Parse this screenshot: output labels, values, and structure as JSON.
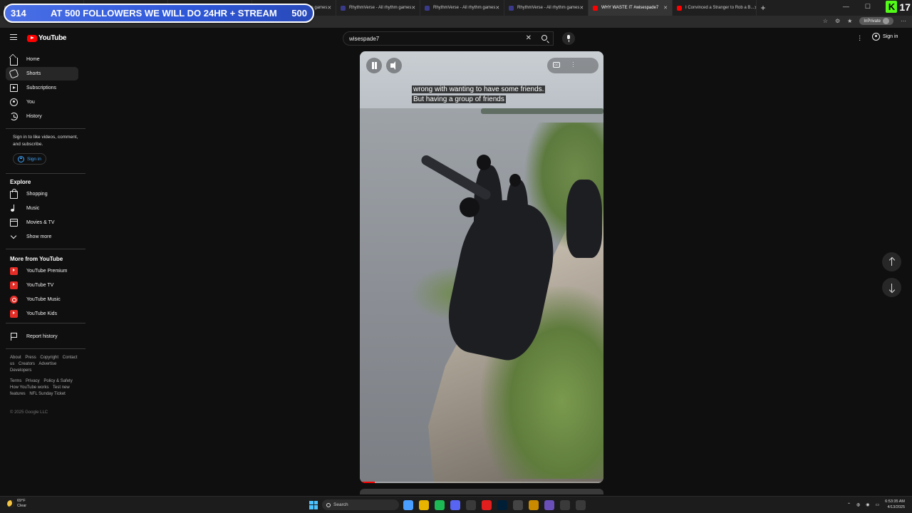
{
  "browser": {
    "tabs": [
      {
        "title": "",
        "color": "#6a6a6a"
      },
      {
        "title": "",
        "color": "#6a6a6a"
      },
      {
        "title": "",
        "color": "#6a6a6a"
      },
      {
        "title": "RhythmVerse - All rhythm games",
        "color": "#3a3a8a"
      },
      {
        "title": "RhythmVerse - All rhythm games",
        "color": "#3a3a8a"
      },
      {
        "title": "RhythmVerse - All rhythm games",
        "color": "#3a3a8a"
      },
      {
        "title": "RhythmVerse - All rhythm games",
        "color": "#3a3a8a"
      },
      {
        "title": "WHY WASTE IT #wisespade7",
        "color": "#ff0000",
        "active": true
      },
      {
        "title": "I Convinced a Stranger to Rob a B...",
        "color": "#ff0000"
      }
    ],
    "new_tab": "+",
    "inprivate_label": "InPrivate"
  },
  "overlay": {
    "followers_current": "314",
    "banner_text": "AT 500 FOLLOWERS WE WILL DO 24HR + STREAM",
    "followers_goal": "500",
    "kick_logo": "K",
    "viewer_count": "17"
  },
  "header": {
    "logo_text": "YouTube",
    "search_value": "wisespade7",
    "clear_label": "✕",
    "signin_label": "Sign in"
  },
  "sidebar": {
    "primary": [
      {
        "label": "Home",
        "icon": "home-icon"
      },
      {
        "label": "Shorts",
        "icon": "shorts-icon",
        "active": true
      },
      {
        "label": "Subscriptions",
        "icon": "subscriptions-icon"
      },
      {
        "label": "You",
        "icon": "you-icon"
      },
      {
        "label": "History",
        "icon": "history-icon"
      }
    ],
    "signin_message": "Sign in to like videos, comment, and subscribe.",
    "signin_button": "Sign in",
    "explore_title": "Explore",
    "explore": [
      {
        "label": "Shopping",
        "icon": "shopping-icon"
      },
      {
        "label": "Music",
        "icon": "music-icon"
      },
      {
        "label": "Movies & TV",
        "icon": "movies-icon"
      },
      {
        "label": "Show more",
        "icon": "chevron-down-icon"
      }
    ],
    "more_title": "More from YouTube",
    "more": [
      {
        "label": "YouTube Premium",
        "icon": "youtube-premium-icon"
      },
      {
        "label": "YouTube TV",
        "icon": "youtube-tv-icon"
      },
      {
        "label": "YouTube Music",
        "icon": "youtube-music-icon"
      },
      {
        "label": "YouTube Kids",
        "icon": "youtube-kids-icon"
      }
    ],
    "report_history": "Report history",
    "footer_links_1": [
      "About",
      "Press",
      "Copyright",
      "Contact us",
      "Creators",
      "Advertise",
      "Developers"
    ],
    "footer_links_2": [
      "Terms",
      "Privacy",
      "Policy & Safety",
      "How YouTube works",
      "Test new features",
      "NFL Sunday Ticket"
    ],
    "copyright": "© 2025 Google LLC"
  },
  "player": {
    "caption_line1": "wrong with wanting to have some friends.",
    "caption_line2": "But having a group of friends",
    "cc_label": "CC",
    "progress": 0.06
  },
  "taskbar": {
    "temperature": "69°F",
    "condition": "Clear",
    "search_placeholder": "Search",
    "time": "6:53:35 AM",
    "date": "4/13/2025",
    "apps": [
      "#4a9eff",
      "#e8b400",
      "#1db954",
      "#5865f2",
      "#3a3a3a",
      "#e01e1e",
      "#001e36",
      "#444",
      "#c98a00",
      "#6a4fb8",
      "#3a3a3a",
      "#3a3a3a"
    ]
  }
}
